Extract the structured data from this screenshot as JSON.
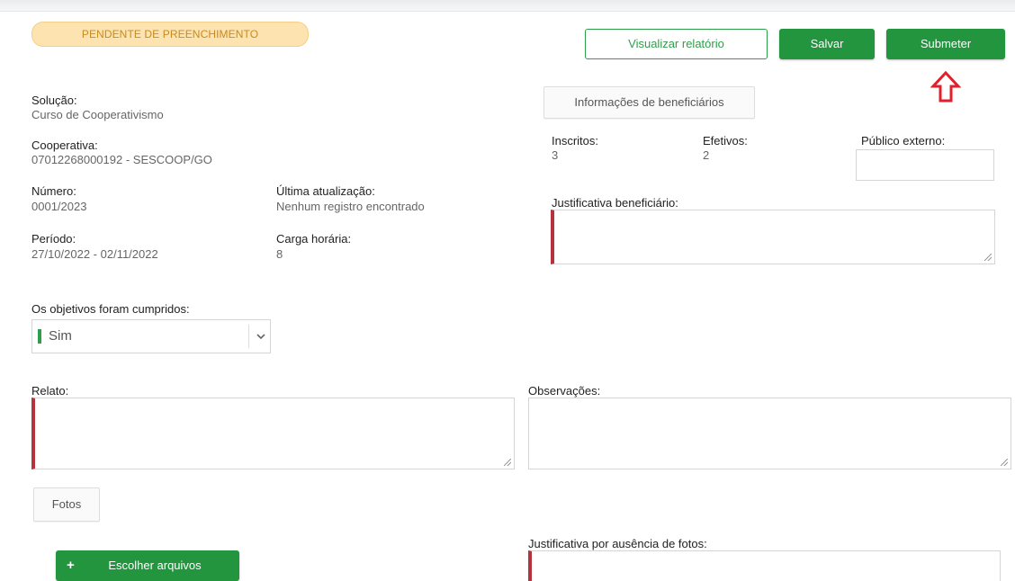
{
  "status": {
    "label": "PENDENTE DE PREENCHIMENTO",
    "color": "#fde3b0"
  },
  "actions": {
    "view_report": "Visualizar relatório",
    "save": "Salvar",
    "submit": "Submeter",
    "accent_color": "#22953e",
    "pointer_icon": "arrow-up-outline-icon"
  },
  "beneficiaries_button": "Informações de beneficiários",
  "info": {
    "solucao": {
      "label": "Solução:",
      "value": "Curso de Cooperativismo"
    },
    "cooperativa": {
      "label": "Cooperativa:",
      "value": "07012268000192 - SESCOOP/GO"
    },
    "numero": {
      "label": "Número:",
      "value": "0001/2023"
    },
    "ultima_atualizacao": {
      "label": "Última atualização:",
      "value": "Nenhum registro encontrado"
    },
    "periodo": {
      "label": "Período:",
      "value": "27/10/2022 - 02/11/2022"
    },
    "carga_horaria": {
      "label": "Carga horária:",
      "value": "8"
    }
  },
  "beneficiaries": {
    "inscritos": {
      "label": "Inscritos:",
      "value": "3"
    },
    "efetivos": {
      "label": "Efetivos:",
      "value": "2"
    },
    "publico_externo": {
      "label": "Público externo:",
      "value": ""
    },
    "justificativa_label": "Justificativa beneficiário:"
  },
  "objectives": {
    "label": "Os objetivos foram cumpridos:",
    "selected": "Sim"
  },
  "relato": {
    "label": "Relato:",
    "value": ""
  },
  "observacoes": {
    "label": "Observações:",
    "value": ""
  },
  "fotos_tab": "Fotos",
  "choose_files": "Escolher arquivos",
  "photo_justification_label": "Justificativa por ausência de fotos:",
  "required_color": "#b5333c"
}
